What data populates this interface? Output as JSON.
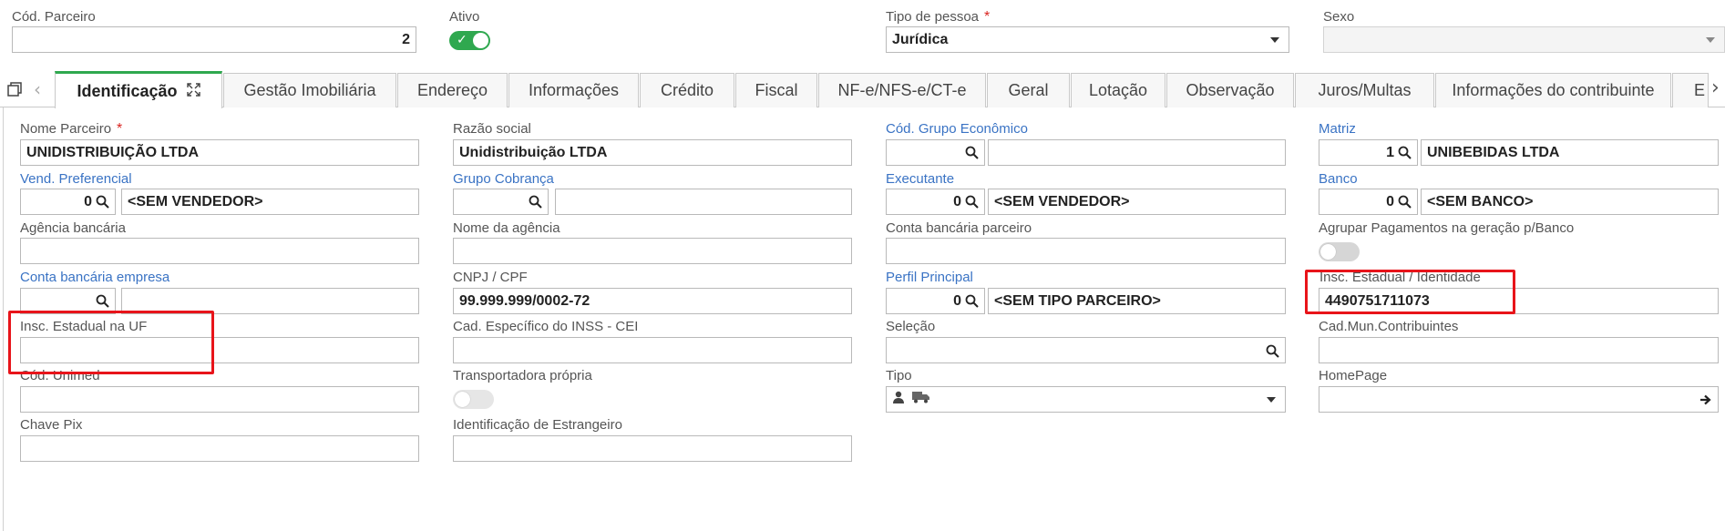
{
  "header": {
    "cod_parceiro_label": "Cód. Parceiro",
    "cod_parceiro_value": "2",
    "ativo_label": "Ativo",
    "ativo_state": "on",
    "tipo_pessoa_label": "Tipo de pessoa",
    "tipo_pessoa_value": "Jurídica",
    "required_mark": "*",
    "sexo_label": "Sexo",
    "sexo_value": ""
  },
  "tabs": [
    {
      "label": "Identificação",
      "active": true
    },
    {
      "label": "Gestão Imobiliária"
    },
    {
      "label": "Endereço"
    },
    {
      "label": "Informações"
    },
    {
      "label": "Crédito"
    },
    {
      "label": "Fiscal"
    },
    {
      "label": "NF-e/NFS-e/CT-e"
    },
    {
      "label": "Geral"
    },
    {
      "label": "Lotação"
    },
    {
      "label": "Observação"
    },
    {
      "label": "Juros/Multas"
    },
    {
      "label": "Informações do contribuinte"
    },
    {
      "label": "E"
    }
  ],
  "form": {
    "nome_parceiro": {
      "label": "Nome Parceiro",
      "value": "UNIDISTRIBUIÇÃO LTDA"
    },
    "razao_social": {
      "label": "Razão social",
      "value": "Unidistribuição LTDA"
    },
    "cod_grupo_economico": {
      "label": "Cód. Grupo Econômico",
      "code": "",
      "desc": ""
    },
    "matriz": {
      "label": "Matriz",
      "code": "1",
      "desc": "UNIBEBIDAS LTDA"
    },
    "vend_preferencial": {
      "label": "Vend. Preferencial",
      "code": "0",
      "desc": "<SEM VENDEDOR>"
    },
    "grupo_cobranca": {
      "label": "Grupo Cobrança",
      "code": "",
      "desc": ""
    },
    "executante": {
      "label": "Executante",
      "code": "0",
      "desc": "<SEM VENDEDOR>"
    },
    "banco": {
      "label": "Banco",
      "code": "0",
      "desc": "<SEM BANCO>"
    },
    "agencia_bancaria": {
      "label": "Agência bancária",
      "value": ""
    },
    "nome_agencia": {
      "label": "Nome da agência",
      "value": ""
    },
    "conta_bancaria_parceiro": {
      "label": "Conta bancária parceiro",
      "value": ""
    },
    "agrupar_pagamentos": {
      "label": "Agrupar Pagamentos na geração p/Banco",
      "state": "off"
    },
    "conta_bancaria_empresa": {
      "label": "Conta bancária empresa",
      "code": "",
      "desc": ""
    },
    "cnpj_cpf": {
      "label": "CNPJ / CPF",
      "value": "99.999.999/0002-72"
    },
    "perfil_principal": {
      "label": "Perfil Principal",
      "code": "0",
      "desc": "<SEM TIPO PARCEIRO>"
    },
    "insc_estadual_identidade": {
      "label": "Insc. Estadual / Identidade",
      "value": "4490751711073"
    },
    "insc_estadual_uf": {
      "label": "Insc. Estadual na UF",
      "value": ""
    },
    "cad_especifico_inss": {
      "label": "Cad. Específico do INSS - CEI",
      "value": ""
    },
    "selecao": {
      "label": "Seleção",
      "value": ""
    },
    "cad_mun_contribuintes": {
      "label": "Cad.Mun.Contribuintes",
      "value": ""
    },
    "cod_unimed": {
      "label": "Cód. Unimed",
      "value": ""
    },
    "transportadora_propria": {
      "label": "Transportadora própria",
      "state": "off"
    },
    "tipo": {
      "label": "Tipo",
      "icons": [
        "person-icon",
        "truck-icon"
      ]
    },
    "homepage": {
      "label": "HomePage",
      "value": ""
    },
    "chave_pix": {
      "label": "Chave Pix",
      "value": ""
    },
    "identificacao_estrangeiro": {
      "label": "Identificação de Estrangeiro",
      "value": ""
    }
  },
  "colors": {
    "accent_green": "#2fa84f",
    "link_blue": "#3a73c4",
    "highlight_red": "#e8141a"
  }
}
